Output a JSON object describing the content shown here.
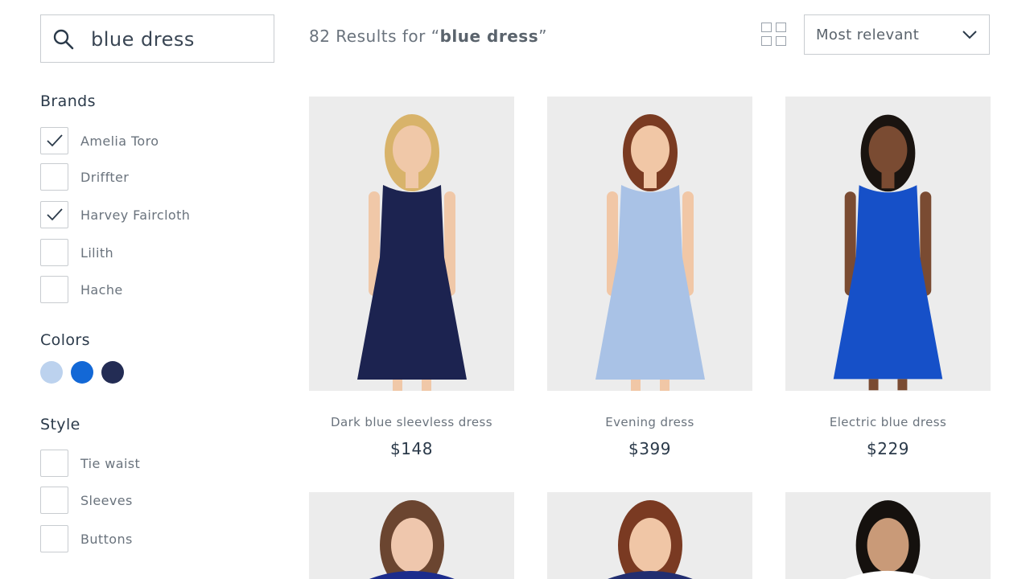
{
  "search": {
    "value": "blue dress",
    "icon": "search-icon"
  },
  "results": {
    "count_text": "82 Results for “",
    "query": "blue dress",
    "suffix": "”"
  },
  "view_toggle": {
    "icon": "grid-view-icon"
  },
  "sort": {
    "selected": "Most relevant",
    "icon": "chevron-down-icon"
  },
  "filters": {
    "brands": {
      "title": "Brands",
      "items": [
        {
          "label": "Amelia Toro",
          "checked": true
        },
        {
          "label": "Driffter",
          "checked": false
        },
        {
          "label": "Harvey Faircloth",
          "checked": true
        },
        {
          "label": "Lilith",
          "checked": false
        },
        {
          "label": "Hache",
          "checked": false
        }
      ]
    },
    "colors": {
      "title": "Colors",
      "swatches": [
        "#bcd2ee",
        "#1368d6",
        "#232c54"
      ]
    },
    "style": {
      "title": "Style",
      "items": [
        {
          "label": "Tie waist",
          "checked": false
        },
        {
          "label": "Sleeves",
          "checked": false
        },
        {
          "label": "Buttons",
          "checked": false
        }
      ]
    }
  },
  "products": [
    {
      "name": "Dark blue sleevless dress",
      "price": "$148",
      "dress_color": "#1c2350",
      "hair": "#d8b36a",
      "skin": "#f0c8a8"
    },
    {
      "name": "Evening dress",
      "price": "$399",
      "dress_color": "#a9c2e6",
      "hair": "#7a3b22",
      "skin": "#f1c7a6"
    },
    {
      "name": "Electric blue dress",
      "price": "$229",
      "dress_color": "#1650c8",
      "hair": "#1a1410",
      "skin": "#7a4b32"
    },
    {
      "name": "",
      "price": "",
      "dress_color": "#1c2c8c",
      "hair": "#6b4530",
      "skin": "#efc7ad"
    },
    {
      "name": "",
      "price": "",
      "dress_color": "#222e70",
      "hair": "#7a3a22",
      "skin": "#f0c6a6"
    },
    {
      "name": "",
      "price": "",
      "dress_color": "#ffffff",
      "hair": "#15110e",
      "skin": "#c99a78"
    }
  ]
}
